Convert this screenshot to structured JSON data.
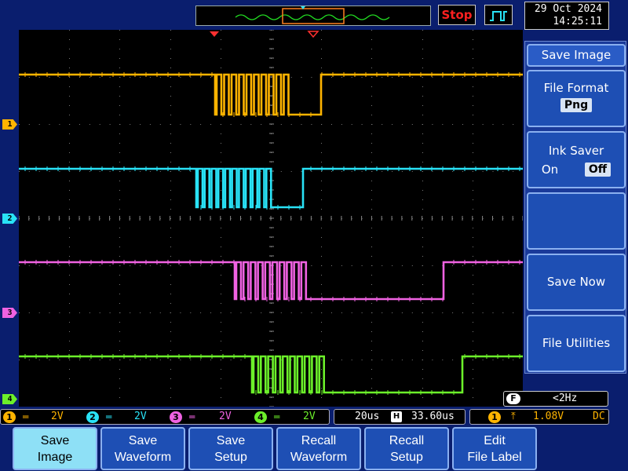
{
  "status_bar_top": {
    "run_state": "Stop",
    "date": "29 Oct 2024",
    "time": "14:25:11"
  },
  "channels": [
    {
      "number": "1",
      "color": "#ffb400",
      "volts_div": "2V",
      "coupling": "DC"
    },
    {
      "number": "2",
      "color": "#29e2f6",
      "volts_div": "2V",
      "coupling": "DC"
    },
    {
      "number": "3",
      "color": "#f062e2",
      "volts_div": "2V",
      "coupling": "DC"
    },
    {
      "number": "4",
      "color": "#6cf02a",
      "volts_div": "2V",
      "coupling": "DC"
    }
  ],
  "timebase": {
    "time_div": "20us",
    "position": "33.60us"
  },
  "trigger": {
    "source": "1",
    "slope": "rising",
    "level": "1.08V",
    "coupling": "DC"
  },
  "frequency_counter": {
    "icon": "F",
    "value": "<2Hz"
  },
  "side_menu": {
    "title": "Save Image",
    "file_format_label": "File Format",
    "file_format_value": "Png",
    "ink_saver_label": "Ink Saver",
    "ink_saver_on": "On",
    "ink_saver_off": "Off",
    "save_now": "Save Now",
    "file_utilities": "File Utilities"
  },
  "soft_keys": [
    {
      "line1": "Save",
      "line2": "Image",
      "active": true
    },
    {
      "line1": "Save",
      "line2": "Waveform",
      "active": false
    },
    {
      "line1": "Save",
      "line2": "Setup",
      "active": false
    },
    {
      "line1": "Recall",
      "line2": "Waveform",
      "active": false
    },
    {
      "line1": "Recall",
      "line2": "Setup",
      "active": false
    },
    {
      "line1": "Edit",
      "line2": "File Label",
      "active": false
    }
  ],
  "colors": {
    "bezel": "#0a1e6e",
    "menu_box": "#1e4fb4",
    "active_key": "#8ee0f6",
    "run_state": "#ff2020",
    "trigger_marker": "#ff3030"
  }
}
